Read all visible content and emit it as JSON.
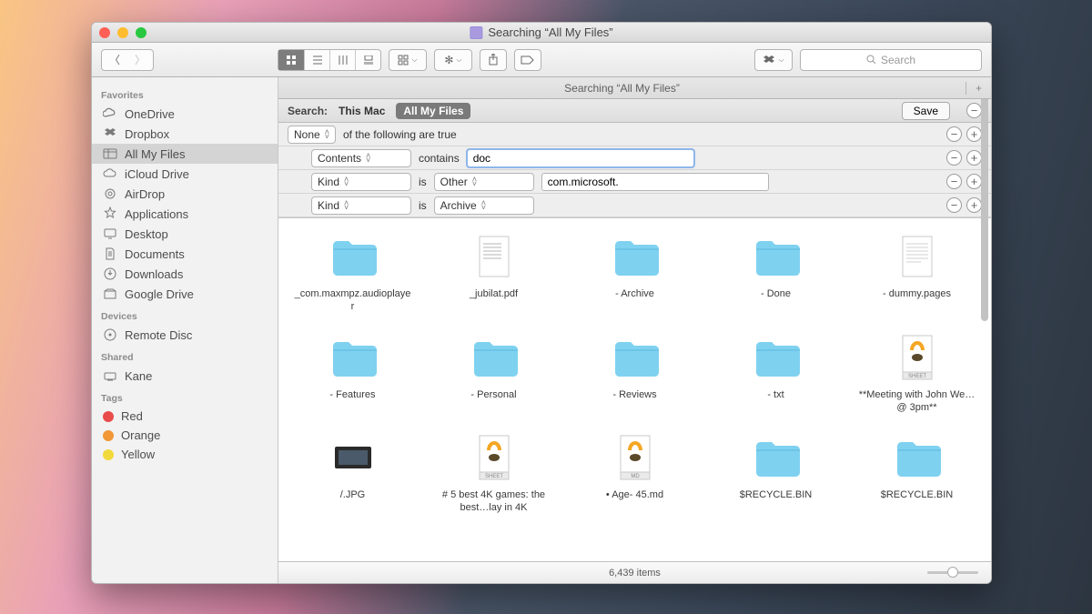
{
  "window": {
    "title": "Searching “All My Files”",
    "search_placeholder": "Search"
  },
  "sidebar": {
    "sections": {
      "favorites": {
        "title": "Favorites",
        "items": [
          {
            "label": "OneDrive"
          },
          {
            "label": "Dropbox"
          },
          {
            "label": "All My Files"
          },
          {
            "label": "iCloud Drive"
          },
          {
            "label": "AirDrop"
          },
          {
            "label": "Applications"
          },
          {
            "label": "Desktop"
          },
          {
            "label": "Documents"
          },
          {
            "label": "Downloads"
          },
          {
            "label": "Google Drive"
          }
        ]
      },
      "devices": {
        "title": "Devices",
        "items": [
          {
            "label": "Remote Disc"
          }
        ]
      },
      "shared": {
        "title": "Shared",
        "items": [
          {
            "label": "Kane"
          }
        ]
      },
      "tags": {
        "title": "Tags",
        "items": [
          {
            "label": "Red",
            "color": "#e94b4b"
          },
          {
            "label": "Orange",
            "color": "#f19737"
          },
          {
            "label": "Yellow",
            "color": "#f1d93b"
          }
        ]
      }
    }
  },
  "tabbar": {
    "label": "Searching “All My Files”"
  },
  "scope": {
    "label": "Search:",
    "thismac": "This Mac",
    "allfiles": "All My Files",
    "save": "Save"
  },
  "criteria": {
    "root": {
      "selector": "None",
      "text": "of the following are true"
    },
    "r1": {
      "field": "Contents",
      "op": "contains",
      "value": "doc"
    },
    "r2": {
      "field": "Kind",
      "op": "is",
      "value_sel": "Other",
      "value_text": "com.microsoft."
    },
    "r3": {
      "field": "Kind",
      "op": "is",
      "value_sel": "Archive"
    }
  },
  "results": {
    "items": [
      {
        "label": "_com.maxmpz.audioplayer",
        "kind": "folder"
      },
      {
        "label": "_jubilat.pdf",
        "kind": "pdf"
      },
      {
        "label": "- Archive",
        "kind": "folder"
      },
      {
        "label": "- Done",
        "kind": "folder"
      },
      {
        "label": "- dummy.pages",
        "kind": "pages"
      },
      {
        "label": "- Features",
        "kind": "folder"
      },
      {
        "label": "- Personal",
        "kind": "folder"
      },
      {
        "label": "- Reviews",
        "kind": "folder"
      },
      {
        "label": "- txt",
        "kind": "folder"
      },
      {
        "label": "**Meeting with John We…@ 3pm**",
        "kind": "sheet"
      },
      {
        "label": "/.JPG",
        "kind": "jpg"
      },
      {
        "label": "# 5 best 4K games: the best…lay in 4K",
        "kind": "sheet"
      },
      {
        "label": "• Age- 45.md",
        "kind": "md"
      },
      {
        "label": "$RECYCLE.BIN",
        "kind": "folder"
      },
      {
        "label": "$RECYCLE.BIN",
        "kind": "folder"
      }
    ]
  },
  "statusbar": {
    "count": "6,439 items"
  }
}
